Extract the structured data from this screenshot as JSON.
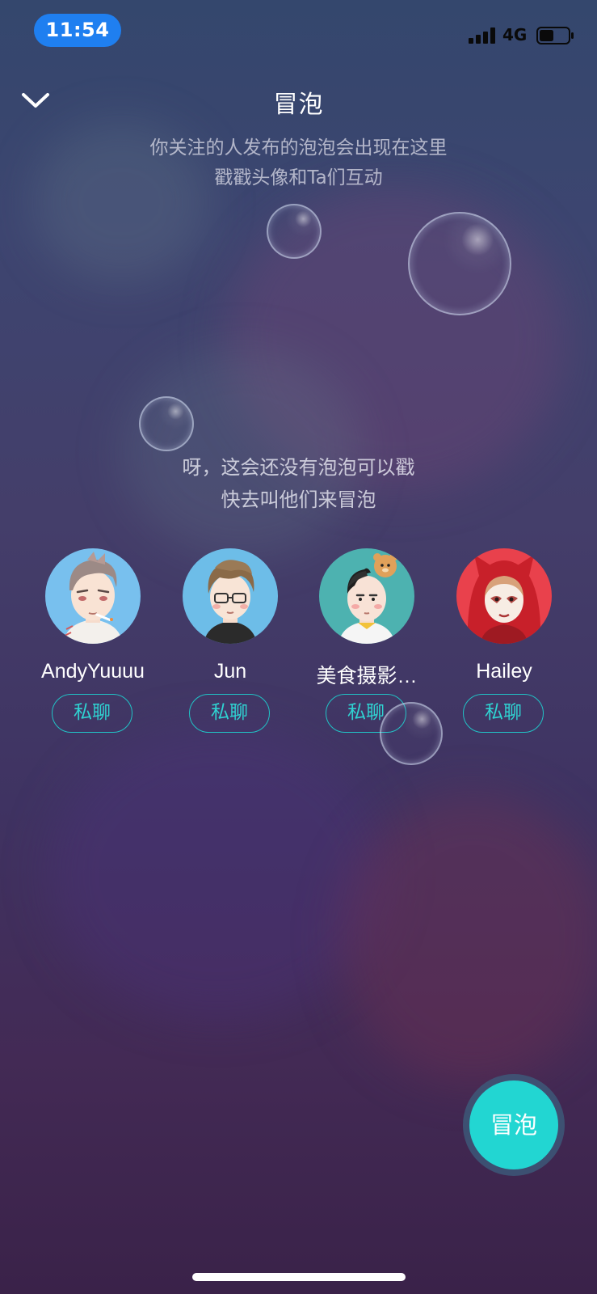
{
  "status_bar": {
    "time": "11:54",
    "network": "4G",
    "signal_icon": "cellular-signal-icon",
    "battery_icon": "battery-icon",
    "battery_level": 0.5
  },
  "header": {
    "back_icon": "chevron-down-icon",
    "title": "冒泡",
    "subtitle_line1": "你关注的人发布的泡泡会出现在这里",
    "subtitle_line2": "戳戳头像和Ta们互动"
  },
  "empty_state": {
    "line1": "呀，这会还没有泡泡可以戳",
    "line2": "快去叫他们来冒泡"
  },
  "users": [
    {
      "name": "AndyYuuuu",
      "chat_label": "私聊",
      "avatar": "avatar-andyyuuuu"
    },
    {
      "name": "Jun",
      "chat_label": "私聊",
      "avatar": "avatar-jun"
    },
    {
      "name": "美食摄影…",
      "chat_label": "私聊",
      "avatar": "avatar-food-photographer"
    },
    {
      "name": "Hailey",
      "chat_label": "私聊",
      "avatar": "avatar-hailey"
    }
  ],
  "fab": {
    "label": "冒泡"
  },
  "colors": {
    "accent": "#22d6d2",
    "time_pill": "#1f7ff0",
    "chat_border": "#21c3c6"
  }
}
